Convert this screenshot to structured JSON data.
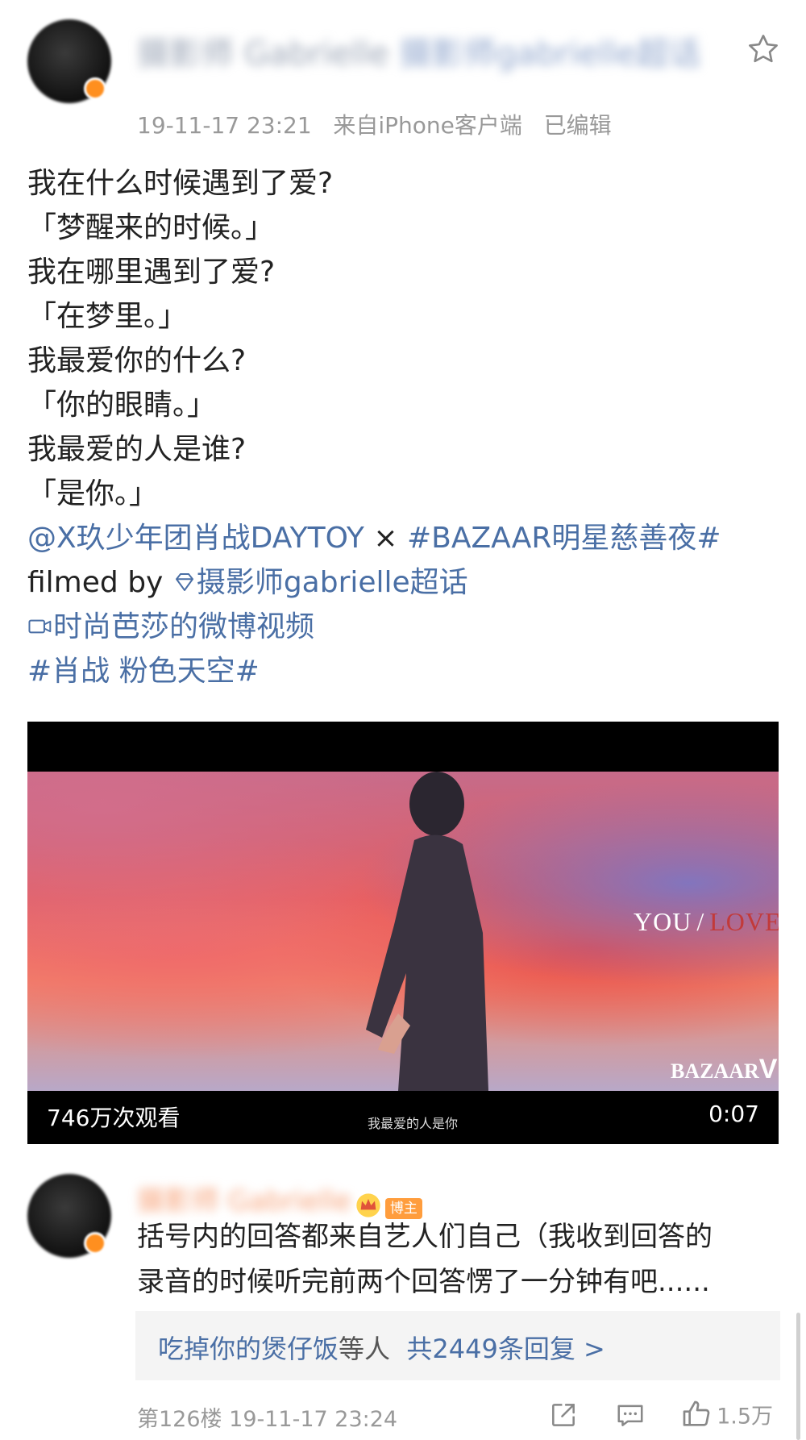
{
  "post": {
    "author_name": "摄影师 Gabrielle",
    "author_badge": "摄影师gabrielle超话",
    "timestamp": "19-11-17 23:21",
    "source": "来自iPhone客户端",
    "edited": "已编辑",
    "lines": [
      "我在什么时候遇到了爱?",
      "「梦醒来的时候。」",
      "我在哪里遇到了爱?",
      "「在梦里。」",
      "我最爱你的什么?",
      "「你的眼睛。」",
      "我最爱的人是谁?",
      "「是你。」"
    ],
    "mention": "@X玖少年团肖战DAYTOY",
    "times_symbol": "×",
    "hashtag_event": "#BAZAAR明星慈善夜#",
    "filmed_by": "filmed by",
    "super_topic": "摄影师gabrielle超话",
    "video_link": "时尚芭莎的微博视频",
    "hashtag_topic": "#肖战 粉色天空#"
  },
  "video": {
    "views": "746万次观看",
    "duration": "0:07",
    "subtitle": "我最爱的人是你",
    "overlay_you": "YOU",
    "overlay_slash": "/",
    "overlay_love": "LOVE",
    "watermark": "BAZAAR"
  },
  "comment": {
    "author_name": "摄影师 Gabrielle",
    "badge": "博主",
    "text_line1": "括号内的回答都来自艺人们自己（我收到回答的",
    "text_line2": "录音的时候听完前两个回答愣了一分钟有吧......",
    "reply_user": "吃掉你的煲仔饭",
    "reply_suffix": "等人",
    "reply_count": "共2449条回复 >",
    "floor": "第126楼",
    "timestamp": "19-11-17 23:24",
    "likes": "1.5万"
  },
  "colors": {
    "link": "#4a6fa5",
    "meta_gray": "#999999",
    "accent_orange": "#ff9d3d"
  }
}
